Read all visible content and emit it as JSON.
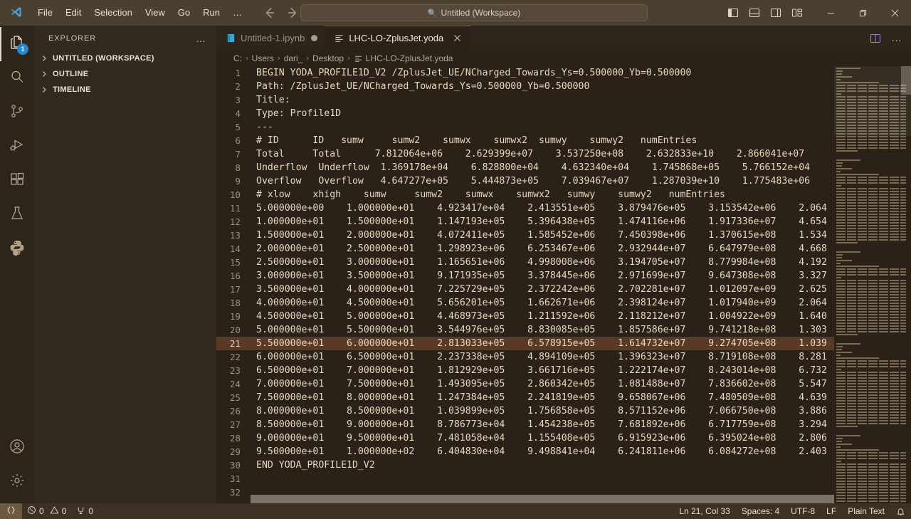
{
  "titlebar": {
    "logo_icon": "vscode-logo-icon",
    "menus": [
      "File",
      "Edit",
      "Selection",
      "View",
      "Go",
      "Run",
      "…"
    ],
    "nav_back_icon": "arrow-left-icon",
    "nav_forward_icon": "arrow-right-icon",
    "search": {
      "icon": "search-icon",
      "value": "Untitled (Workspace)",
      "placeholder": "Search"
    },
    "layout_icons": [
      "toggle-primary-sidebar-icon",
      "toggle-panel-icon",
      "toggle-secondary-sidebar-icon",
      "customize-layout-icon"
    ],
    "window_controls": {
      "minimize": "minimize-icon",
      "maximize": "restore-icon",
      "close": "close-icon"
    }
  },
  "activitybar": {
    "items": [
      {
        "name": "explorer",
        "icon": "files-icon",
        "badge": "1",
        "active": true
      },
      {
        "name": "search",
        "icon": "search-icon",
        "badge": "",
        "active": false
      },
      {
        "name": "source-control",
        "icon": "source-control-icon",
        "badge": "",
        "active": false
      },
      {
        "name": "run-and-debug",
        "icon": "run-debug-icon",
        "badge": "",
        "active": false
      },
      {
        "name": "extensions",
        "icon": "extensions-icon",
        "badge": "",
        "active": false
      },
      {
        "name": "testing",
        "icon": "beaker-icon",
        "badge": "",
        "active": false
      },
      {
        "name": "python",
        "icon": "python-icon",
        "badge": "",
        "active": false
      }
    ],
    "bottom": [
      {
        "name": "accounts",
        "icon": "account-icon"
      },
      {
        "name": "settings",
        "icon": "gear-icon"
      }
    ]
  },
  "sidebar": {
    "title": "EXPLORER",
    "more_actions_icon": "ellipsis-icon",
    "sections": [
      {
        "label": "UNTITLED (WORKSPACE)",
        "expanded": false
      },
      {
        "label": "OUTLINE",
        "expanded": false
      },
      {
        "label": "TIMELINE",
        "expanded": false
      }
    ]
  },
  "editor": {
    "tabs": [
      {
        "label": "Untitled-1.ipynb",
        "icon": "notebook-icon",
        "active": false,
        "dirty": true,
        "closeable": false
      },
      {
        "label": "LHC-LO-ZplusJet.yoda",
        "icon": "file-text-icon",
        "active": true,
        "dirty": false,
        "closeable": true
      }
    ],
    "tab_actions": [
      "split-editor-right-icon",
      "more-actions-icon"
    ],
    "breadcrumbs": [
      "C:",
      "Users",
      "dari_",
      "Desktop",
      "LHC-LO-ZplusJet.yoda"
    ],
    "breadcrumb_file_icon": "file-text-icon",
    "highlight_line": 21,
    "lines": [
      {
        "n": "1",
        "text": "BEGIN YODA_PROFILE1D_V2 /ZplusJet_UE/NCharged_Towards_Ys=0.500000_Yb=0.500000"
      },
      {
        "n": "2",
        "text": "Path: /ZplusJet_UE/NCharged_Towards_Ys=0.500000_Yb=0.500000"
      },
      {
        "n": "3",
        "text": "Title:"
      },
      {
        "n": "4",
        "text": "Type: Profile1D"
      },
      {
        "n": "5",
        "text": "---"
      },
      {
        "n": "6",
        "text": "# ID      ID   sumw     sumw2    sumwx    sumwx2  sumwy    sumwy2   numEntries"
      },
      {
        "n": "7",
        "text": "Total     Total      7.812064e+06    2.629399e+07    3.537250e+08    2.632833e+10    2.866041e+07"
      },
      {
        "n": "8",
        "text": "Underflow  Underflow  1.369178e+04    6.828800e+04    4.632340e+04    1.745868e+05    5.766152e+04"
      },
      {
        "n": "9",
        "text": "Overflow   Overflow   4.647277e+05    5.444873e+05    7.039467e+07    1.287039e+10    1.775483e+06"
      },
      {
        "n": "10",
        "text": "# xlow    xhigh    sumw     sumw2    sumwx    sumwx2   sumwy    sumwy2   numEntries"
      },
      {
        "n": "11",
        "text": "5.000000e+00    1.000000e+01    4.923417e+04    2.413551e+05    3.879476e+05    3.153542e+06    2.064"
      },
      {
        "n": "12",
        "text": "1.000000e+01    1.500000e+01    1.147193e+05    5.396438e+05    1.474116e+06    1.917336e+07    4.654"
      },
      {
        "n": "13",
        "text": "1.500000e+01    2.000000e+01    4.072411e+05    1.585452e+06    7.450398e+06    1.370615e+08    1.534"
      },
      {
        "n": "14",
        "text": "2.000000e+01    2.500000e+01    1.298923e+06    6.253467e+06    2.932944e+07    6.647979e+08    4.668"
      },
      {
        "n": "15",
        "text": "2.500000e+01    3.000000e+01    1.165651e+06    4.998008e+06    3.194705e+07    8.779984e+08    4.192"
      },
      {
        "n": "16",
        "text": "3.000000e+01    3.500000e+01    9.171935e+05    3.378445e+06    2.971699e+07    9.647308e+08    3.327"
      },
      {
        "n": "17",
        "text": "3.500000e+01    4.000000e+01    7.225729e+05    2.372242e+06    2.702281e+07    1.012097e+09    2.625"
      },
      {
        "n": "18",
        "text": "4.000000e+01    4.500000e+01    5.656201e+05    1.662671e+06    2.398124e+07    1.017940e+09    2.064"
      },
      {
        "n": "19",
        "text": "4.500000e+01    5.000000e+01    4.468973e+05    1.211592e+06    2.118212e+07    1.004922e+09    1.640"
      },
      {
        "n": "20",
        "text": "5.000000e+01    5.500000e+01    3.544976e+05    8.830085e+05    1.857586e+07    9.741218e+08    1.303"
      },
      {
        "n": "21",
        "text": "5.500000e+01    6.000000e+01    2.813033e+05    6.578915e+05    1.614732e+07    9.274705e+08    1.039"
      },
      {
        "n": "22",
        "text": "6.000000e+01    6.500000e+01    2.237338e+05    4.894109e+05    1.396323e+07    8.719108e+08    8.281"
      },
      {
        "n": "23",
        "text": "6.500000e+01    7.000000e+01    1.812929e+05    3.661716e+05    1.222174e+07    8.243014e+08    6.732"
      },
      {
        "n": "24",
        "text": "7.000000e+01    7.500000e+01    1.493095e+05    2.860342e+05    1.081488e+07    7.836602e+08    5.547"
      },
      {
        "n": "25",
        "text": "7.500000e+01    8.000000e+01    1.247384e+05    2.241819e+05    9.658067e+06    7.480509e+08    4.639"
      },
      {
        "n": "26",
        "text": "8.000000e+01    8.500000e+01    1.039899e+05    1.756858e+05    8.571152e+06    7.066750e+08    3.886"
      },
      {
        "n": "27",
        "text": "8.500000e+01    9.000000e+01    8.786773e+04    1.454238e+05    7.681892e+06    6.717759e+08    3.294"
      },
      {
        "n": "28",
        "text": "9.000000e+01    9.500000e+01    7.481058e+04    1.155408e+05    6.915923e+06    6.395024e+08    2.806"
      },
      {
        "n": "29",
        "text": "9.500000e+01    1.000000e+02    6.404830e+04    9.498841e+04    6.241811e+06    6.084272e+08    2.403"
      },
      {
        "n": "30",
        "text": "END YODA_PROFILE1D_V2"
      },
      {
        "n": "31",
        "text": ""
      },
      {
        "n": "32",
        "text": ""
      }
    ]
  },
  "statusbar": {
    "remote_icon": "remote-window-icon",
    "problems": {
      "errors_icon": "error-icon",
      "errors": "0",
      "warnings_icon": "warning-icon",
      "warnings": "0"
    },
    "ports": {
      "icon": "ports-icon",
      "count": "0"
    },
    "cursor_position": "Ln 21, Col 33",
    "indentation": "Spaces: 4",
    "encoding": "UTF-8",
    "eol": "LF",
    "language_mode": "Plain Text",
    "notifications_icon": "bell-icon"
  },
  "colors": {
    "titlebar_bg": "#4b3f2f",
    "activitybar_bg": "#2d2519",
    "sidebar_bg": "#322a1e",
    "editor_bg": "#2a2218",
    "statusbar_bg": "#3b3124",
    "accent_badge": "#1f8ad2",
    "highlight_line_bg": "#5a3a26",
    "code_fg": "#e8d9bf"
  }
}
